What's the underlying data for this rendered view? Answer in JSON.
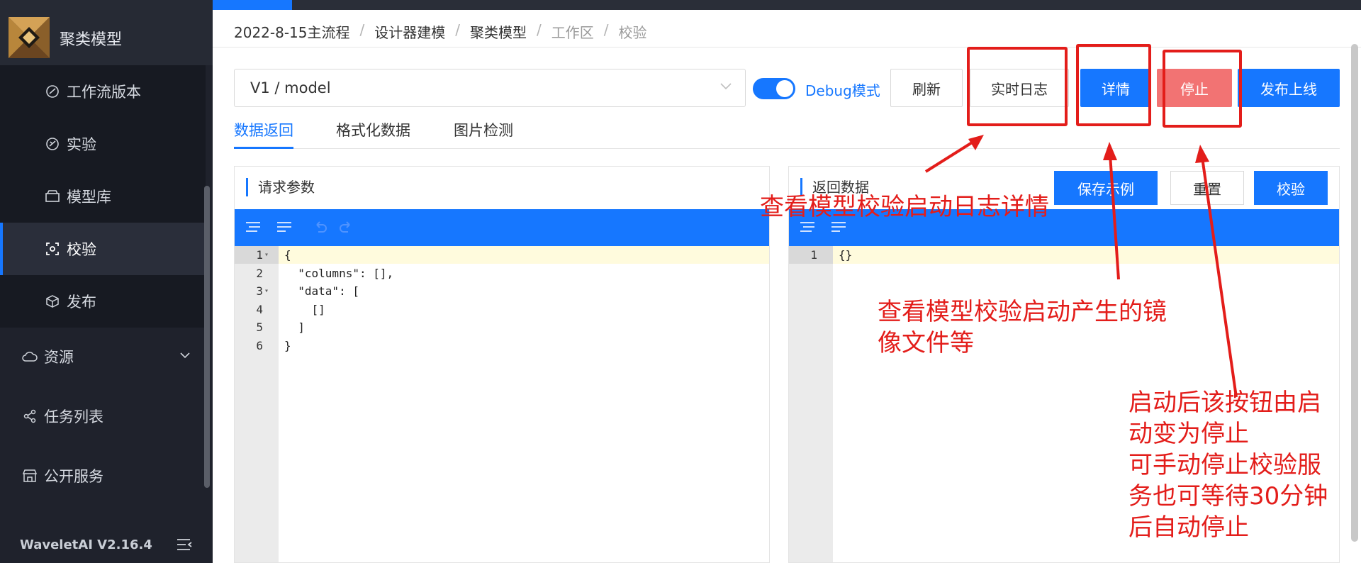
{
  "sidebar": {
    "title": "聚类模型",
    "items": [
      {
        "label": "工作流版本",
        "icon": "workflow-icon"
      },
      {
        "label": "实验",
        "icon": "experiment-icon"
      },
      {
        "label": "模型库",
        "icon": "model-library-icon"
      },
      {
        "label": "校验",
        "icon": "scan-icon"
      },
      {
        "label": "发布",
        "icon": "cube-icon"
      }
    ],
    "groups": [
      {
        "label": "资源",
        "icon": "cloud-icon"
      },
      {
        "label": "任务列表",
        "icon": "share-icon"
      },
      {
        "label": "公开服务",
        "icon": "store-icon"
      }
    ],
    "version": "WaveletAI V2.16.4"
  },
  "breadcrumb": [
    "2022-8-15主流程",
    "设计器建模",
    "聚类模型",
    "工作区",
    "校验"
  ],
  "toolbar": {
    "model_value": "V1 / model",
    "debug_label": "Debug模式",
    "debug_on": true,
    "refresh_label": "刷新",
    "log_label": "实时日志",
    "detail_label": "详情",
    "stop_label": "停止",
    "publish_label": "发布上线"
  },
  "tabs": [
    "数据返回",
    "格式化数据",
    "图片检测"
  ],
  "left_panel": {
    "title": "请求参数",
    "lines": [
      {
        "num": "1",
        "fold": true,
        "text": "{"
      },
      {
        "num": "2",
        "fold": false,
        "text": "  \"columns\": [],"
      },
      {
        "num": "3",
        "fold": true,
        "text": "  \"data\": ["
      },
      {
        "num": "4",
        "fold": false,
        "text": "    []"
      },
      {
        "num": "5",
        "fold": false,
        "text": "  ]"
      },
      {
        "num": "6",
        "fold": false,
        "text": "}"
      }
    ]
  },
  "right_panel": {
    "title": "返回数据",
    "save_label": "保存示例",
    "reset_label": "重置",
    "verify_label": "校验",
    "lines": [
      {
        "num": "1",
        "fold": false,
        "text": "{}"
      }
    ]
  },
  "annotations": {
    "log_note": "查看模型校验启动日志详情",
    "detail_note_1": "查看模型校验启动产生的镜",
    "detail_note_2": "像文件等",
    "stop_note_1": "启动后该按钮由启",
    "stop_note_2": "动变为停止",
    "stop_note_3": "可手动停止校验服",
    "stop_note_4": "务也可等待30分钟",
    "stop_note_5": "后自动停止"
  },
  "colors": {
    "primary": "#1677ff",
    "danger": "#f27373",
    "annotation": "#e31d1a",
    "sidebar": "#1f222c"
  }
}
